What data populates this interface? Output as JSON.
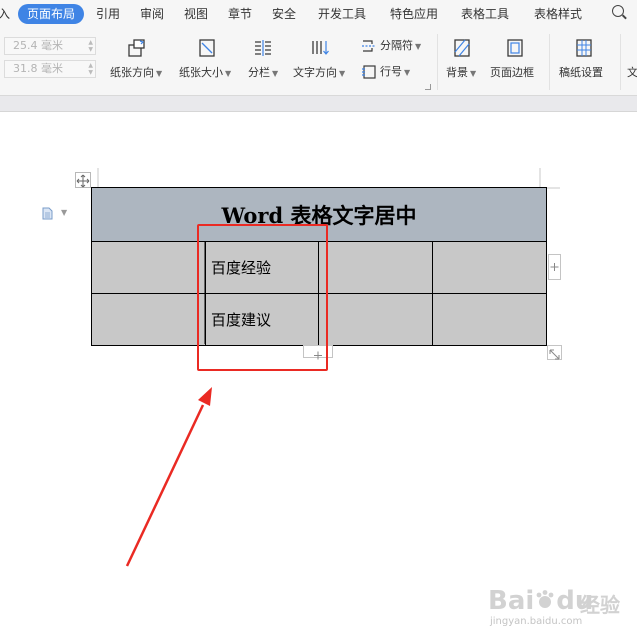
{
  "menu": {
    "tabs": [
      {
        "label": "入"
      },
      {
        "label": "页面布局",
        "active": true
      },
      {
        "label": "引用"
      },
      {
        "label": "审阅"
      },
      {
        "label": "视图"
      },
      {
        "label": "章节"
      },
      {
        "label": "安全"
      },
      {
        "label": "开发工具"
      },
      {
        "label": "特色应用"
      },
      {
        "label": "表格工具"
      },
      {
        "label": "表格样式"
      }
    ],
    "search_label": "Q"
  },
  "ribbon": {
    "margin_top": "25.4 毫米",
    "margin_bottom": "31.8 毫米",
    "orientation_label": "纸张方向",
    "size_label": "纸张大小",
    "columns_label": "分栏",
    "text_direction_label": "文字方向",
    "breaks_label": "分隔符",
    "line_number_label": "行号",
    "background_label": "背景",
    "page_border_label": "页面边框",
    "manuscript_label": "稿纸设置",
    "cut_label": "文"
  },
  "document": {
    "table": {
      "title": "Word 表格文字居中",
      "rows": [
        [
          "",
          "百度经验",
          "",
          ""
        ],
        [
          "",
          "百度建议",
          "",
          ""
        ]
      ]
    }
  },
  "colors": {
    "accent": "#3f84e5",
    "highlight": "#ea2a23",
    "title_cell": "#adb6c0",
    "body_cell": "#c8c8c8"
  },
  "watermark": {
    "logo": "Bai",
    "logo_paw": "du",
    "brand": "经验",
    "url": "jingyan.baidu.com"
  }
}
